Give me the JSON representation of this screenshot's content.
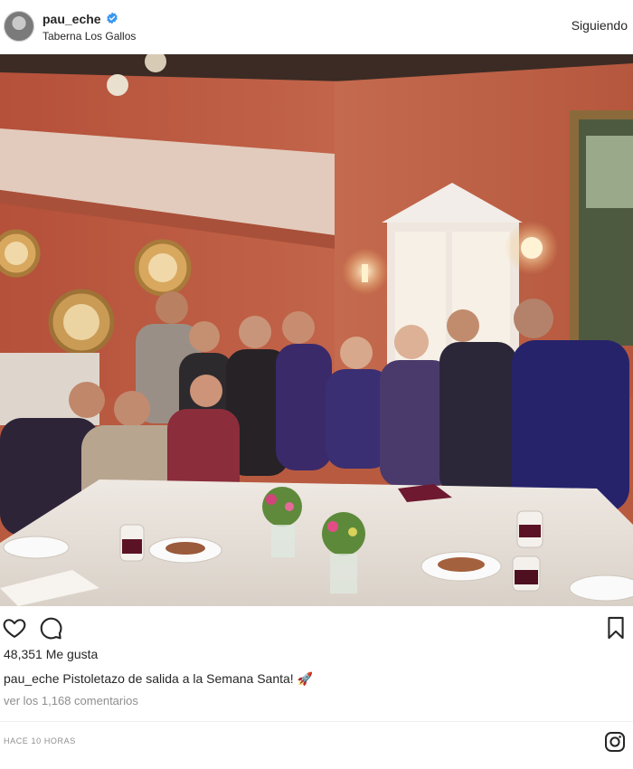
{
  "post": {
    "username": "pau_eche",
    "location": "Taberna Los Gallos",
    "follow_label": "Siguiendo",
    "likes": "48,351 Me gusta",
    "caption_user": "pau_eche",
    "caption_text": "Pistoletazo de salida a la Semana Santa! 🚀",
    "comments_link": "ver los 1,168 comentarios",
    "timestamp": "HACE 10 HORAS"
  },
  "icons": {
    "verified": "verified-badge-icon",
    "like": "heart-icon",
    "comment": "comment-bubble-icon",
    "save": "bookmark-icon",
    "brand": "instagram-icon"
  },
  "colors": {
    "verified": "#3897f0",
    "text": "#262626",
    "muted": "#8e8e8e"
  }
}
